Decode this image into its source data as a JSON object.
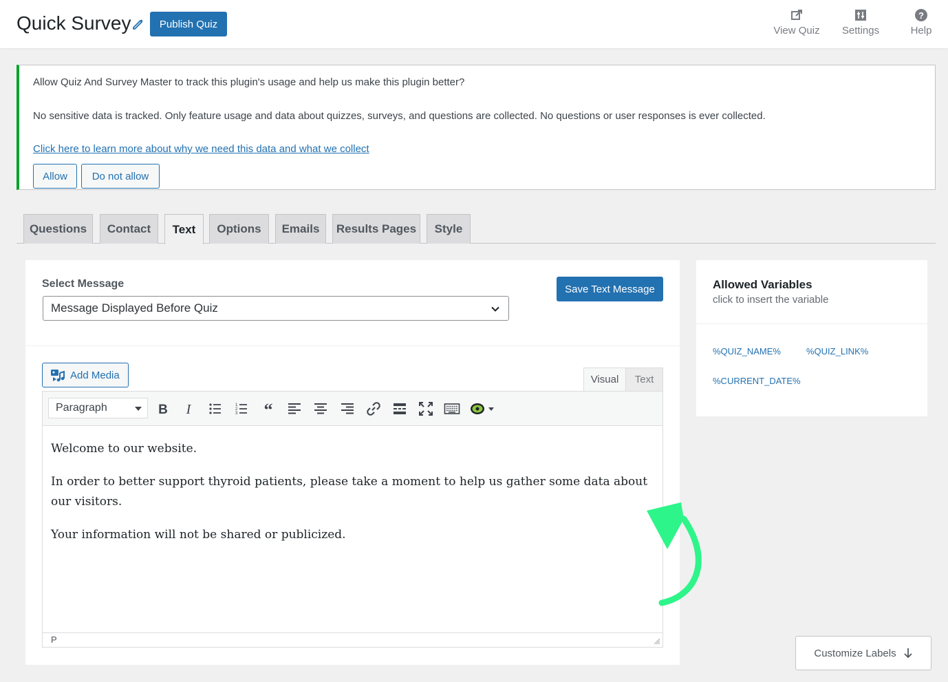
{
  "header": {
    "title": "Quick Survey",
    "publish_label": "Publish Quiz",
    "links": [
      {
        "label": "View Quiz",
        "icon": "external-link-icon"
      },
      {
        "label": "Settings",
        "icon": "sliders-icon"
      },
      {
        "label": "Help",
        "icon": "help-icon"
      }
    ]
  },
  "notice": {
    "line1": "Allow Quiz And Survey Master to track this plugin's usage and help us make this plugin better?",
    "line2": "No sensitive data is tracked. Only feature usage and data about quizzes, surveys, and questions are collected. No questions or user responses is ever collected.",
    "link": "Click here to learn more about why we need this data and what we collect",
    "allow_label": "Allow",
    "deny_label": "Do not allow",
    "accent_color": "#00a32a"
  },
  "tabs": [
    {
      "label": "Questions",
      "active": false
    },
    {
      "label": "Contact",
      "active": false
    },
    {
      "label": "Text",
      "active": true
    },
    {
      "label": "Options",
      "active": false
    },
    {
      "label": "Emails",
      "active": false
    },
    {
      "label": "Results Pages",
      "active": false
    },
    {
      "label": "Style",
      "active": false
    }
  ],
  "main": {
    "select_label": "Select Message",
    "select_value": "Message Displayed Before Quiz",
    "save_label": "Save Text Message",
    "add_media_label": "Add Media",
    "mode_tabs": {
      "visual": "Visual",
      "text": "Text"
    },
    "format_value": "Paragraph",
    "toolbar_icons": [
      "bold-icon",
      "italic-icon",
      "bullet-list-icon",
      "numbered-list-icon",
      "blockquote-icon",
      "align-left-icon",
      "align-center-icon",
      "align-right-icon",
      "link-icon",
      "read-more-icon",
      "fullscreen-icon",
      "keyboard-icon",
      "plugin-icon"
    ],
    "content": [
      "Welcome to our website.",
      "In order to better support thyroid patients, please take a moment to help us gather some data about our visitors.",
      "Your information will not be shared or publicized."
    ],
    "status_path": "P"
  },
  "side": {
    "title": "Allowed Variables",
    "subtitle": "click to insert the variable",
    "variables": [
      "%QUIZ_NAME%",
      "%QUIZ_LINK%",
      "%CURRENT_DATE%"
    ]
  },
  "customize_label": "Customize Labels",
  "colors": {
    "primary": "#2271b1",
    "annotation_arrow": "#2df58a"
  }
}
